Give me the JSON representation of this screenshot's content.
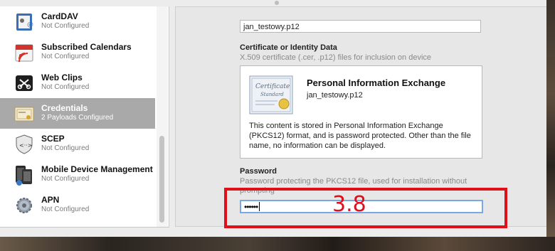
{
  "sidebar": {
    "items": [
      {
        "title": "CardDAV",
        "subtitle": "Not Configured",
        "icon": "carddav-icon",
        "selected": false
      },
      {
        "title": "Subscribed Calendars",
        "subtitle": "Not Configured",
        "icon": "calendar-icon",
        "selected": false
      },
      {
        "title": "Web Clips",
        "subtitle": "Not Configured",
        "icon": "web-clips-icon",
        "selected": false
      },
      {
        "title": "Credentials",
        "subtitle": "2 Payloads Configured",
        "icon": "certificate-icon",
        "selected": true
      },
      {
        "title": "SCEP",
        "subtitle": "Not Configured",
        "icon": "scep-icon",
        "selected": false
      },
      {
        "title": "Mobile Device Management",
        "subtitle": "Not Configured",
        "icon": "mdm-icon",
        "selected": false
      },
      {
        "title": "APN",
        "subtitle": "Not Configured",
        "icon": "gear-icon",
        "selected": false
      }
    ]
  },
  "main": {
    "name_value": "jan_testowy.p12",
    "certificate": {
      "label": "Certificate or Identity Data",
      "description": "X.509 certificate (.cer, .p12) files for inclusion on device",
      "image_text_1": "Certificate",
      "image_text_2": "Standard",
      "title": "Personal Information Exchange",
      "filename": "jan_testowy.p12",
      "info": "This content is stored in Personal Information Exchange (PKCS12) format, and is password protected.  Other than the file name, no information can be displayed."
    },
    "password": {
      "label": "Password",
      "description": "Password protecting the PKCS12 file, used for installation without prompting",
      "value": "••••••"
    }
  },
  "annotation": {
    "text": "3.8",
    "color": "#e0101a"
  },
  "colors": {
    "selected_row": "#a9a9a9",
    "focus_ring": "#78a9e6"
  }
}
